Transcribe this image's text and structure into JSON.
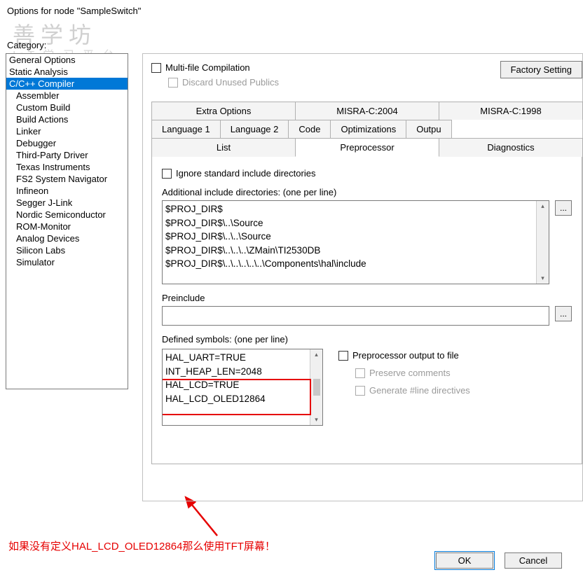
{
  "window_title": "Options for node \"SampleSwitch\"",
  "watermark": {
    "main": "善学坊",
    "sub": "IoT 学 习 平 台"
  },
  "category_label": "Category:",
  "categories": [
    {
      "label": "General Options",
      "indent": false,
      "selected": false
    },
    {
      "label": "Static Analysis",
      "indent": false,
      "selected": false
    },
    {
      "label": "C/C++ Compiler",
      "indent": false,
      "selected": true
    },
    {
      "label": "Assembler",
      "indent": true,
      "selected": false
    },
    {
      "label": "Custom Build",
      "indent": true,
      "selected": false
    },
    {
      "label": "Build Actions",
      "indent": true,
      "selected": false
    },
    {
      "label": "Linker",
      "indent": true,
      "selected": false
    },
    {
      "label": "Debugger",
      "indent": true,
      "selected": false
    },
    {
      "label": "Third-Party Driver",
      "indent": true,
      "selected": false
    },
    {
      "label": "Texas Instruments",
      "indent": true,
      "selected": false
    },
    {
      "label": "FS2 System Navigator",
      "indent": true,
      "selected": false
    },
    {
      "label": "Infineon",
      "indent": true,
      "selected": false
    },
    {
      "label": "Segger J-Link",
      "indent": true,
      "selected": false
    },
    {
      "label": "Nordic Semiconductor",
      "indent": true,
      "selected": false
    },
    {
      "label": "ROM-Monitor",
      "indent": true,
      "selected": false
    },
    {
      "label": "Analog Devices",
      "indent": true,
      "selected": false
    },
    {
      "label": "Silicon Labs",
      "indent": true,
      "selected": false
    },
    {
      "label": "Simulator",
      "indent": true,
      "selected": false
    }
  ],
  "factory_button": "Factory Setting",
  "multifile": {
    "label": "Multi-file Compilation",
    "discard": "Discard Unused Publics"
  },
  "tabs_row1": [
    "Extra Options",
    "MISRA-C:2004",
    "MISRA-C:1998"
  ],
  "tabs_row2": [
    "Language 1",
    "Language 2",
    "Code",
    "Optimizations",
    "Outpu"
  ],
  "tabs_row3": [
    "List",
    "Preprocessor",
    "Diagnostics"
  ],
  "active_tab": "Preprocessor",
  "preprocessor": {
    "ignore_std": "Ignore standard include directories",
    "addl_label": "Additional include directories: (one per line)",
    "addl_dirs": [
      "$PROJ_DIR$",
      "$PROJ_DIR$\\..\\Source",
      "$PROJ_DIR$\\..\\..\\Source",
      "$PROJ_DIR$\\..\\..\\..\\ZMain\\TI2530DB",
      "$PROJ_DIR$\\..\\..\\..\\..\\..\\Components\\hal\\include"
    ],
    "preinclude_label": "Preinclude",
    "defined_label": "Defined symbols: (one per line)",
    "defined_symbols": [
      "HAL_UART=TRUE",
      "INT_HEAP_LEN=2048",
      "HAL_LCD=TRUE",
      "HAL_LCD_OLED12864"
    ],
    "pp_output": "Preprocessor output to file",
    "preserve": "Preserve comments",
    "gen_line": "Generate #line directives"
  },
  "browse_ellipsis": "...",
  "annotation": "如果没有定义HAL_LCD_OLED12864那么使用TFT屏幕！",
  "buttons": {
    "ok": "OK",
    "cancel": "Cancel"
  }
}
